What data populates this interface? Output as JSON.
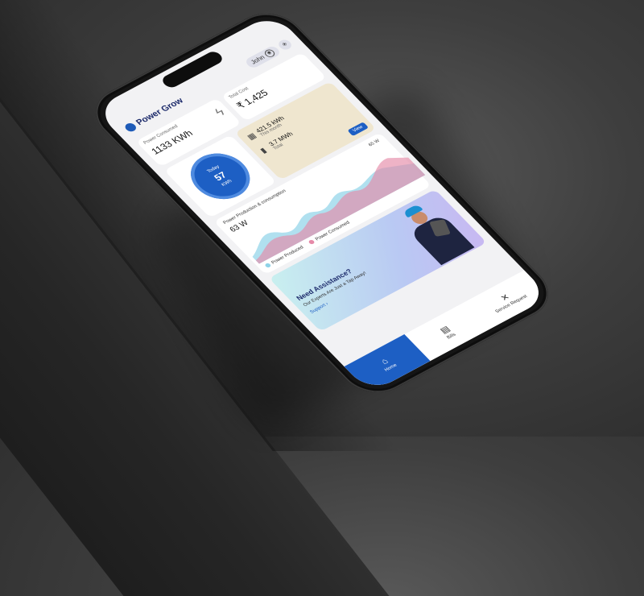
{
  "app": {
    "brand": "Power Grow"
  },
  "header": {
    "user": "John"
  },
  "power_consumed": {
    "label": "Power Consumed",
    "value": "1133 KWh"
  },
  "total_cost": {
    "label": "Total Cost",
    "value": "₹ 1,425"
  },
  "today": {
    "label": "Today",
    "value": "57",
    "unit": "KWh"
  },
  "month": {
    "value": "421.5 kWh",
    "label": "This month"
  },
  "total": {
    "value": "3.7 MWh",
    "label": "Total"
  },
  "view_button": "View",
  "chart": {
    "title": "Power Production & consumption",
    "current": "63 W",
    "peak": "65 W",
    "legend_produced": "Power Produced",
    "legend_consumed": "Power Consumed"
  },
  "assist": {
    "title": "Need Assistance?",
    "subtitle": "Our Experts Are Just a Tap Away!",
    "link": "Support ›"
  },
  "tabs": {
    "home": "Home",
    "bills": "Bills",
    "service": "Service Request"
  },
  "colors": {
    "accent": "#1d5fc4",
    "brand": "#1d2b6b",
    "produced": "#8fd3e8",
    "consumed": "#e58aa8"
  }
}
